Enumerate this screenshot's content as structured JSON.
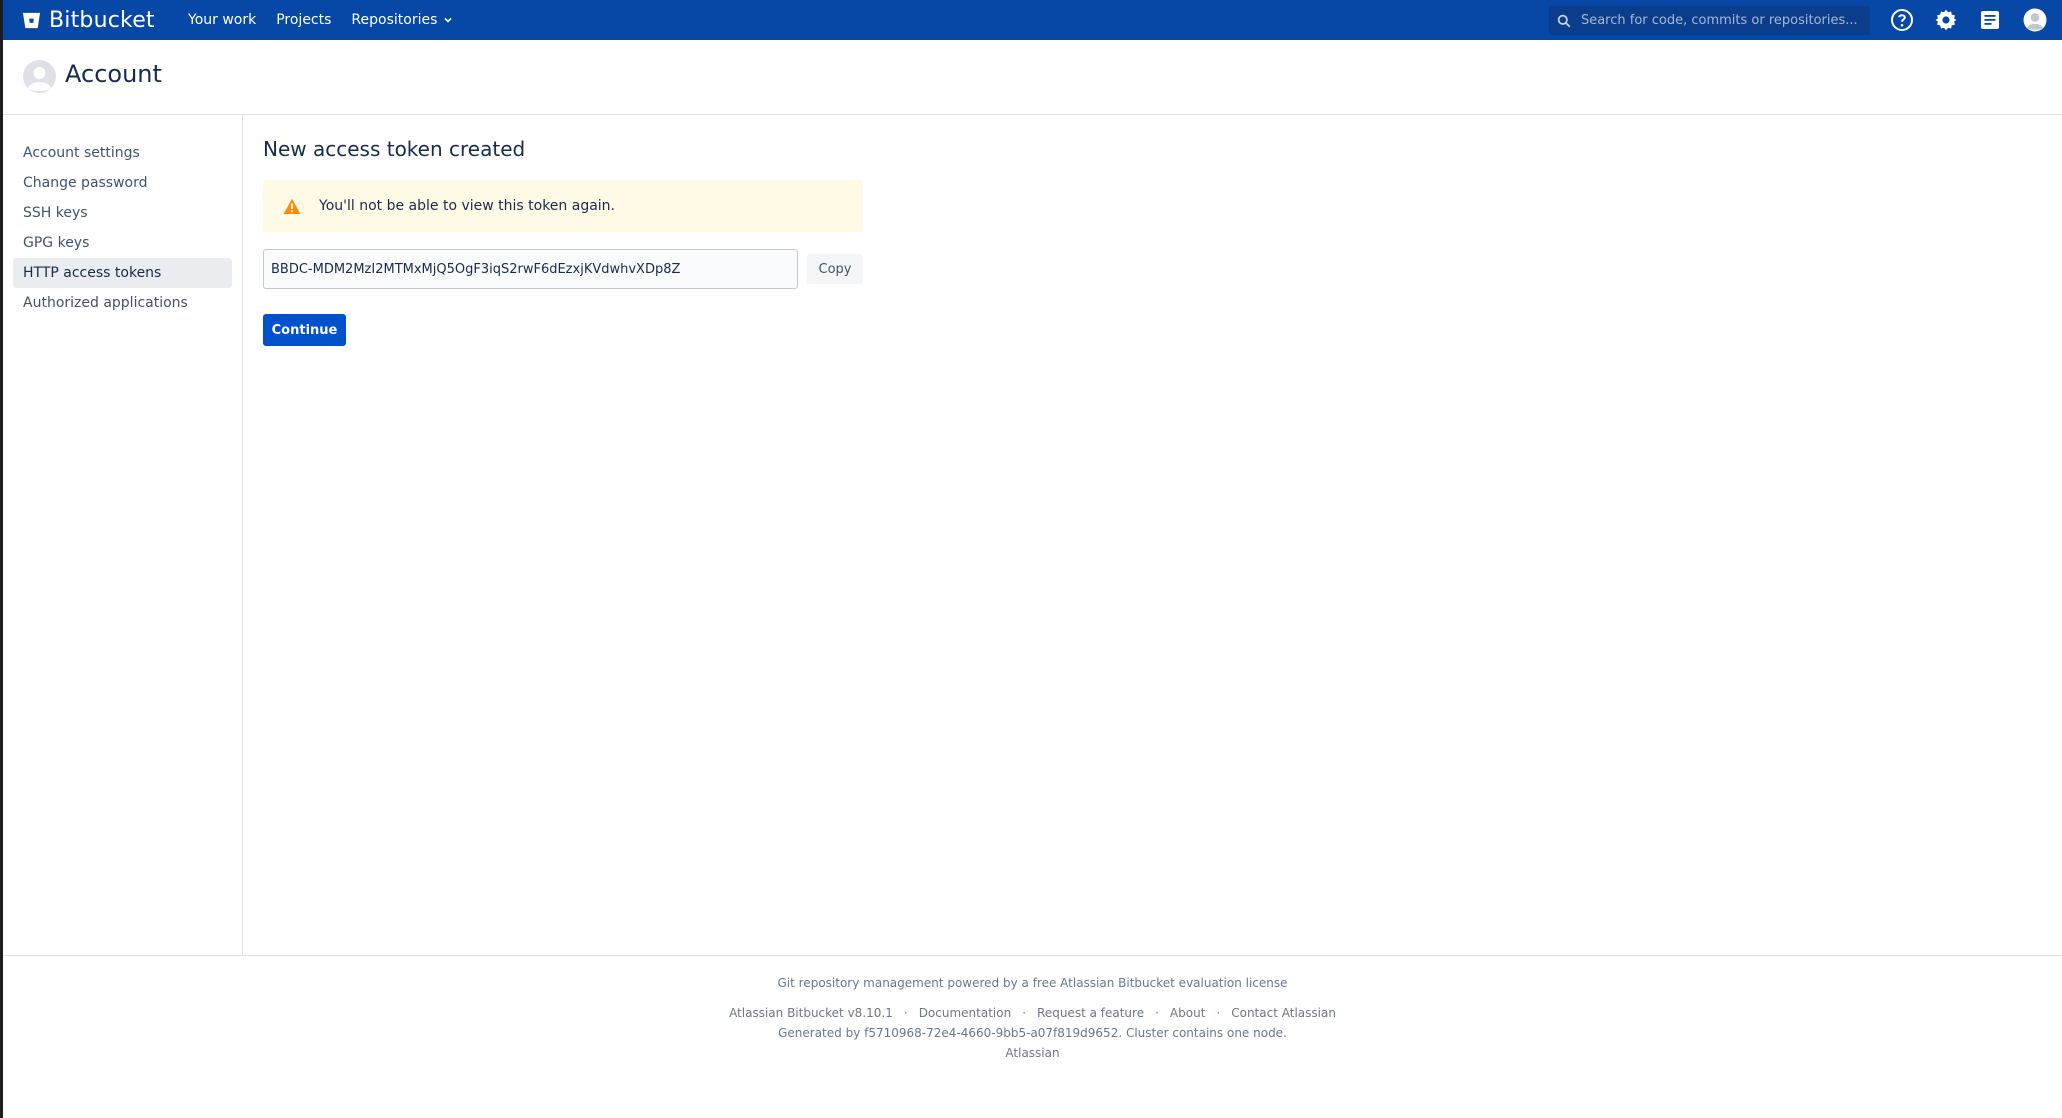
{
  "header": {
    "brand": "Bitbucket",
    "nav": [
      {
        "label": "Your work"
      },
      {
        "label": "Projects"
      },
      {
        "label": "Repositories"
      }
    ],
    "search_placeholder": "Search for code, commits or repositories..."
  },
  "page": {
    "title": "Account"
  },
  "sidebar": {
    "items": [
      {
        "label": "Account settings"
      },
      {
        "label": "Change password"
      },
      {
        "label": "SSH keys"
      },
      {
        "label": "GPG keys"
      },
      {
        "label": "HTTP access tokens",
        "active": true
      },
      {
        "label": "Authorized applications"
      }
    ]
  },
  "main": {
    "title": "New access token created",
    "warning": "You'll not be able to view this token again.",
    "token": "BBDC-MDM2MzI2MTMxMjQ5OgF3iqS2rwF6dEzxjKVdwhvXDp8Z",
    "copy_label": "Copy",
    "continue_label": "Continue"
  },
  "footer": {
    "line1": "Git repository management powered by a free Atlassian Bitbucket evaluation license",
    "links": [
      {
        "label": "Atlassian Bitbucket v8.10.1"
      },
      {
        "label": "Documentation"
      },
      {
        "label": "Request a feature"
      },
      {
        "label": "About"
      },
      {
        "label": "Contact Atlassian"
      }
    ],
    "separator": "·",
    "generated": "Generated by f5710968-72e4-4660-9bb5-a07f819d9652. Cluster contains one node.",
    "vendor": "Atlassian"
  },
  "colors": {
    "header_bg": "#0747a6",
    "primary_button": "#0052cc",
    "warning_bg": "#fffae6",
    "warning_icon": "#ff8b00"
  }
}
